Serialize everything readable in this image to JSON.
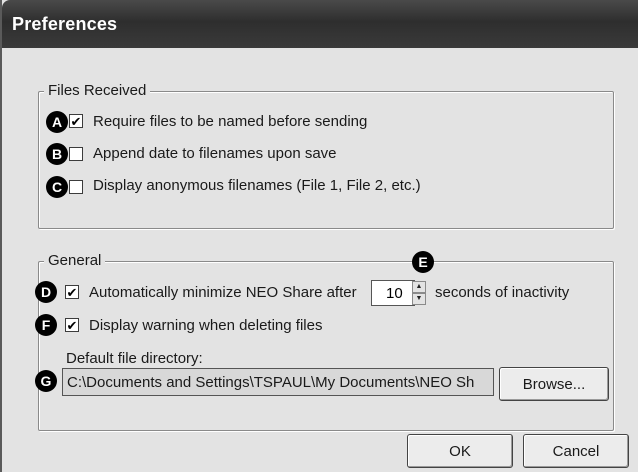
{
  "window": {
    "title": "Preferences"
  },
  "files_received": {
    "legend": "Files Received",
    "items": [
      {
        "badge": "A",
        "label": "Require files to be named before sending",
        "checked": true
      },
      {
        "badge": "B",
        "label": "Append date to filenames upon save",
        "checked": false
      },
      {
        "badge": "C",
        "label": "Display anonymous filenames (File 1, File 2, etc.)",
        "checked": false
      }
    ]
  },
  "general": {
    "legend": "General",
    "minimize": {
      "badge": "D",
      "label": "Automatically minimize NEO Share after",
      "checked": true,
      "value": "10",
      "suffix": "seconds of inactivity",
      "spinner_badge": "E"
    },
    "warning": {
      "badge": "F",
      "label": "Display warning when deleting files",
      "checked": true
    },
    "directory": {
      "label": "Default file directory:",
      "badge": "G",
      "value": "C:\\Documents and Settings\\TSPAUL\\My Documents\\NEO Sh",
      "browse_label": "Browse..."
    }
  },
  "buttons": {
    "ok": "OK",
    "cancel": "Cancel"
  },
  "icons": {
    "check": "✔",
    "up": "▲",
    "down": "▼"
  }
}
